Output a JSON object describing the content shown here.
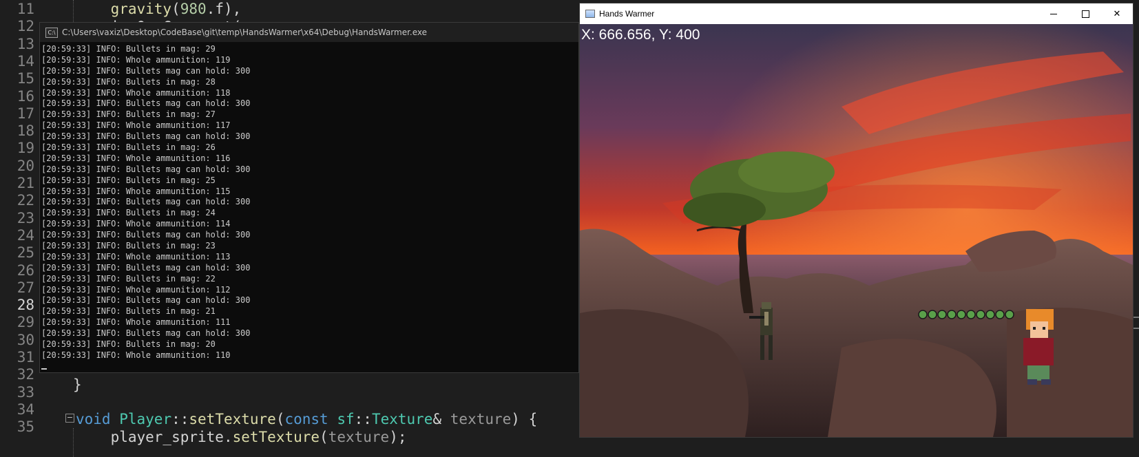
{
  "editor": {
    "line_numbers": [
      "11",
      "12",
      "13",
      "14",
      "15",
      "16",
      "17",
      "18",
      "19",
      "20",
      "21",
      "22",
      "23",
      "24",
      "25",
      "26",
      "27",
      "28",
      "29",
      "30",
      "31",
      "32",
      "33",
      "34",
      "35"
    ],
    "current_line": "28",
    "line_11_call": "gravity",
    "line_11_args": "980",
    "line_11_tail": ".f),",
    "line_12_partial": "    i  O  C      t(",
    "line_31_brace": "}",
    "line_33": {
      "kw_void": "void",
      "class_name": "Player",
      "sep": "::",
      "method": "setTexture",
      "paren_open": "(",
      "kw_const": "const",
      "ns": "sf",
      "sep2": "::",
      "type": "Texture",
      "amp": "&",
      "param": "texture",
      "tail": ") {"
    },
    "line_34": {
      "object": "player_sprite",
      "dot": ".",
      "method": "setTexture",
      "open": "(",
      "arg": "texture",
      "close": ");"
    }
  },
  "console": {
    "title": "C:\\Users\\vaxiz\\Desktop\\CodeBase\\git\\temp\\HandsWarmer\\x64\\Debug\\HandsWarmer.exe",
    "icon": "cmd-icon",
    "lines": [
      "[20:59:33] INFO: Bullets in mag: 29",
      "[20:59:33] INFO: Whole ammunition: 119",
      "[20:59:33] INFO: Bullets mag can hold: 300",
      "[20:59:33] INFO: Bullets in mag: 28",
      "[20:59:33] INFO: Whole ammunition: 118",
      "[20:59:33] INFO: Bullets mag can hold: 300",
      "[20:59:33] INFO: Bullets in mag: 27",
      "[20:59:33] INFO: Whole ammunition: 117",
      "[20:59:33] INFO: Bullets mag can hold: 300",
      "[20:59:33] INFO: Bullets in mag: 26",
      "[20:59:33] INFO: Whole ammunition: 116",
      "[20:59:33] INFO: Bullets mag can hold: 300",
      "[20:59:33] INFO: Bullets in mag: 25",
      "[20:59:33] INFO: Whole ammunition: 115",
      "[20:59:33] INFO: Bullets mag can hold: 300",
      "[20:59:33] INFO: Bullets in mag: 24",
      "[20:59:33] INFO: Whole ammunition: 114",
      "[20:59:33] INFO: Bullets mag can hold: 300",
      "[20:59:33] INFO: Bullets in mag: 23",
      "[20:59:33] INFO: Whole ammunition: 113",
      "[20:59:33] INFO: Bullets mag can hold: 300",
      "[20:59:33] INFO: Bullets in mag: 22",
      "[20:59:33] INFO: Whole ammunition: 112",
      "[20:59:33] INFO: Bullets mag can hold: 300",
      "[20:59:33] INFO: Bullets in mag: 21",
      "[20:59:33] INFO: Whole ammunition: 111",
      "[20:59:33] INFO: Bullets mag can hold: 300",
      "[20:59:33] INFO: Bullets in mag: 20",
      "[20:59:33] INFO: Whole ammunition: 110"
    ]
  },
  "game_window": {
    "title": "Hands Warmer",
    "coords_text": "X: 666.656, Y: 400",
    "enemy_health_pips": 10,
    "colors": {
      "sky_top": "#5a3a6e",
      "sky_glow": "#ff5a1e",
      "rock": "#6b4a40",
      "tree_foliage": "#4f6a2a"
    }
  }
}
